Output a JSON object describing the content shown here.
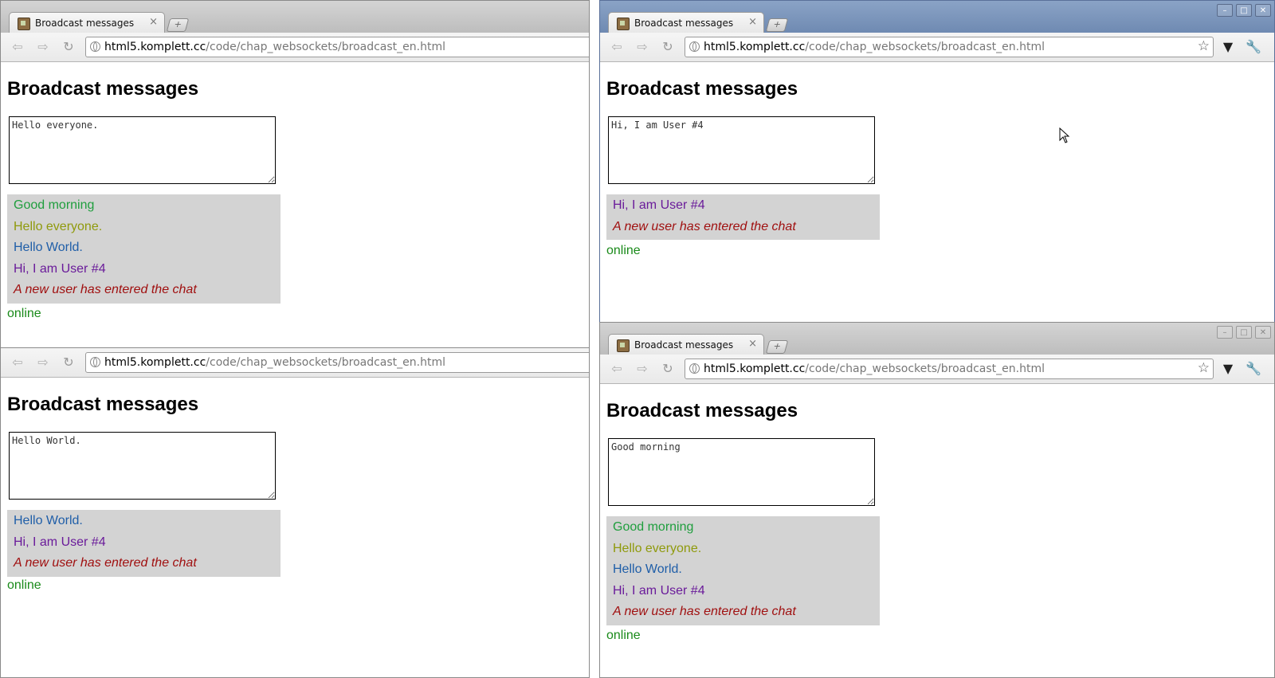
{
  "colors": {
    "green": "#1f9e3d",
    "olive": "#8f9a0c",
    "blue": "#1f5ea8",
    "purple": "#6a1b9a",
    "system": "#a01010",
    "status": "#1a8a1a"
  },
  "windows": [
    {
      "tab": {
        "title": "Broadcast messages",
        "close": "×"
      },
      "url": {
        "host": "html5.komplett.cc",
        "path": "/code/chap_websockets/broadcast_en.html"
      },
      "heading": "Broadcast messages",
      "input_value": "Hello everyone.",
      "messages": [
        {
          "text": "Good morning",
          "color": "#1f9e3d"
        },
        {
          "text": "Hello everyone.",
          "color": "#8f9a0c"
        },
        {
          "text": "Hello World.",
          "color": "#1f5ea8"
        },
        {
          "text": "Hi, I am User #4",
          "color": "#6a1b9a"
        },
        {
          "text": "A new user has entered the chat",
          "color": "#a01010",
          "system": true
        }
      ],
      "status": "online"
    },
    {
      "tab": {
        "title": "Broadcast messages",
        "close": "×"
      },
      "url": {
        "host": "html5.komplett.cc",
        "path": "/code/chap_websockets/broadcast_en.html"
      },
      "heading": "Broadcast messages",
      "input_value": "Hi, I am User #4",
      "messages": [
        {
          "text": "Hi, I am User #4",
          "color": "#6a1b9a"
        },
        {
          "text": "A new user has entered the chat",
          "color": "#a01010",
          "system": true
        }
      ],
      "status": "online"
    },
    {
      "tab": null,
      "url": {
        "host": "html5.komplett.cc",
        "path": "/code/chap_websockets/broadcast_en.html"
      },
      "heading": "Broadcast messages",
      "input_value": "Hello World.",
      "messages": [
        {
          "text": "Hello World.",
          "color": "#1f5ea8"
        },
        {
          "text": "Hi, I am User #4",
          "color": "#6a1b9a"
        },
        {
          "text": "A new user has entered the chat",
          "color": "#a01010",
          "system": true
        }
      ],
      "status": "online"
    },
    {
      "tab": {
        "title": "Broadcast messages",
        "close": "×"
      },
      "url": {
        "host": "html5.komplett.cc",
        "path": "/code/chap_websockets/broadcast_en.html"
      },
      "heading": "Broadcast messages",
      "input_value": "Good morning",
      "messages": [
        {
          "text": "Good morning",
          "color": "#1f9e3d"
        },
        {
          "text": "Hello everyone.",
          "color": "#8f9a0c"
        },
        {
          "text": "Hello World.",
          "color": "#1f5ea8"
        },
        {
          "text": "Hi, I am User #4",
          "color": "#6a1b9a"
        },
        {
          "text": "A new user has entered the chat",
          "color": "#a01010",
          "system": true
        }
      ],
      "status": "online"
    }
  ],
  "icons": {
    "back": "back-arrow-icon",
    "forward": "forward-arrow-icon",
    "reload": "reload-icon",
    "star": "bookmark-star-icon",
    "page_menu": "page-menu-icon",
    "wrench": "wrench-icon",
    "new_tab": "new-tab-icon",
    "minimize": "minimize-icon",
    "maximize": "maximize-icon",
    "close_window": "close-window-icon"
  }
}
